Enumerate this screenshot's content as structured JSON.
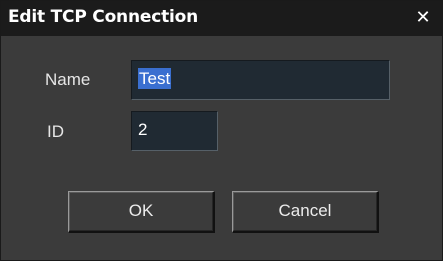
{
  "window": {
    "title": "Edit TCP Connection",
    "close_glyph": "✕"
  },
  "form": {
    "name_label": "Name",
    "name_value": "Test",
    "id_label": "ID",
    "id_value": "2"
  },
  "buttons": {
    "ok_label": "OK",
    "cancel_label": "Cancel"
  }
}
